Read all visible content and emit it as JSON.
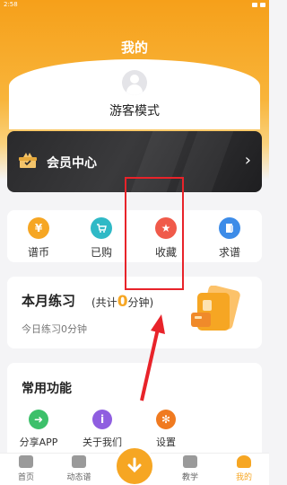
{
  "status_bar": {
    "time": "2:58"
  },
  "header": {
    "title": "我的"
  },
  "profile": {
    "name": "游客模式"
  },
  "vip": {
    "label": "会员中心",
    "arrow": "›"
  },
  "quick_actions": [
    {
      "label": "谱币",
      "icon": "coin-bag-icon",
      "color": "#f6a623"
    },
    {
      "label": "已购",
      "icon": "cart-icon",
      "color": "#2fb9c6"
    },
    {
      "label": "收藏",
      "icon": "star-icon",
      "color": "#f05a4a"
    },
    {
      "label": "求谱",
      "icon": "sheet-music-icon",
      "color": "#3d8ce8"
    }
  ],
  "practice": {
    "title": "本月练习",
    "total_prefix": "(共计",
    "total_value": "0",
    "total_suffix": "分钟)",
    "today": "今日练习0分钟"
  },
  "functions": {
    "title": "常用功能",
    "items": [
      {
        "label": "分享APP",
        "icon": "share-icon",
        "color": "#3cc06a"
      },
      {
        "label": "关于我们",
        "icon": "info-icon",
        "color": "#8f5ee0"
      },
      {
        "label": "设置",
        "icon": "gear-icon",
        "color": "#f07a20"
      }
    ]
  },
  "tab_bar": {
    "tabs": [
      {
        "label": "首页",
        "icon": "home-icon"
      },
      {
        "label": "动态谱",
        "icon": "dynamic-score-icon"
      },
      {
        "label": "教学",
        "icon": "teaching-icon"
      },
      {
        "label": "我的",
        "icon": "profile-icon",
        "active": true
      }
    ],
    "center_icon": "download-arrow-icon"
  },
  "annotation": {
    "highlight_color": "#e8232a"
  }
}
